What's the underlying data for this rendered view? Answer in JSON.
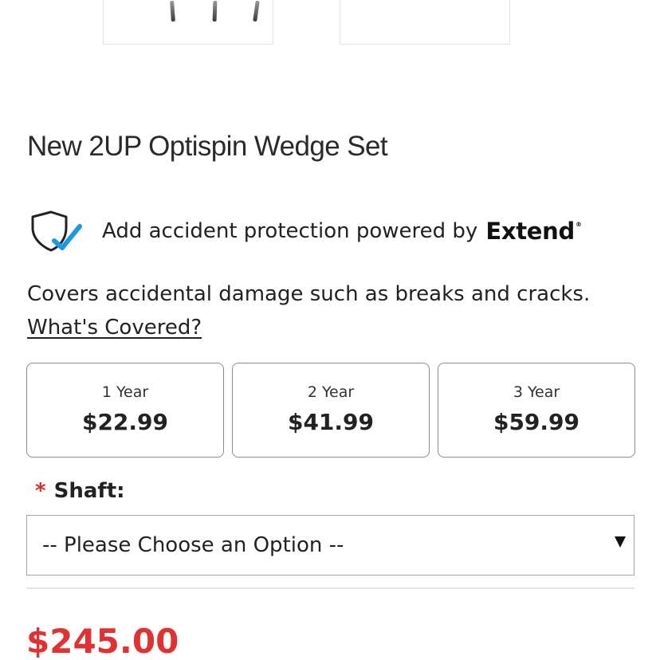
{
  "product": {
    "title": "New 2UP Optispin Wedge Set",
    "price": "$245.00"
  },
  "protection": {
    "text": "Add accident protection powered by",
    "brand": "Extend",
    "brand_mark": "®",
    "description": "Covers accidental damage such as breaks and cracks.",
    "link_label": "What's Covered?",
    "icon": "shield-check-icon",
    "check_color": "#1a9be0"
  },
  "plans": [
    {
      "term": "1 Year",
      "price": "$22.99"
    },
    {
      "term": "2 Year",
      "price": "$41.99"
    },
    {
      "term": "3 Year",
      "price": "$59.99"
    }
  ],
  "options": {
    "required_mark": "*",
    "shaft_label": "Shaft:",
    "shaft_value": "-- Please Choose an Option --"
  },
  "colors": {
    "price": "#e03232",
    "required": "#e02a2a"
  }
}
